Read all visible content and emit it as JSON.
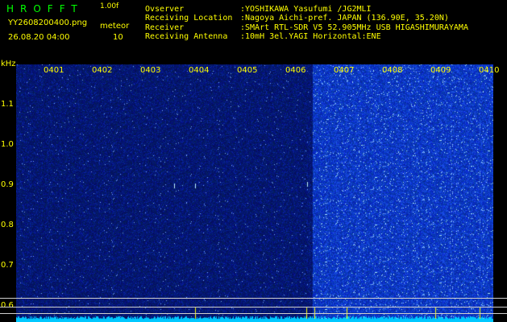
{
  "header": {
    "logo": "HROFFT",
    "version": "1.00f",
    "filename": "YY2608200400.png",
    "datetime": "26.08.20 04:00",
    "mode_label": "meteor",
    "mode_count": "10",
    "info": [
      {
        "label": "Ovserver",
        "value": ":YOSHIKAWA Yasufumi /JG2MLI"
      },
      {
        "label": "Receiving Location",
        "value": ":Nagoya Aichi-pref. JAPAN (136.90E, 35.20N)"
      },
      {
        "label": "Receiver",
        "value": ":SMArt RTL-SDR V5 52.905MHz USB HIGASHIMURAYAMA"
      },
      {
        "label": "Receiving Antenna",
        "value": ":10mH 3el.YAGI Horizontal:ENE"
      }
    ]
  },
  "axis": {
    "unit": "kHz",
    "freq_ticks": [
      "1.1",
      "1.0",
      "0.9",
      "0.8",
      "0.7",
      "0.6"
    ],
    "minute_labels": [
      "0401",
      "0402",
      "0403",
      "0404",
      "0405",
      "0406",
      "0407",
      "0408",
      "0409",
      "0410"
    ]
  },
  "colors": {
    "background": "#000000",
    "text": "#ffff00",
    "logo": "#00ff00",
    "noise_low": "#0a1a6e",
    "noise_high": "#1f3fd8",
    "hot_pixel": "#9fe6ff",
    "baseline": "#00c8ff"
  },
  "icons": [
    "tick-mark-icon"
  ]
}
